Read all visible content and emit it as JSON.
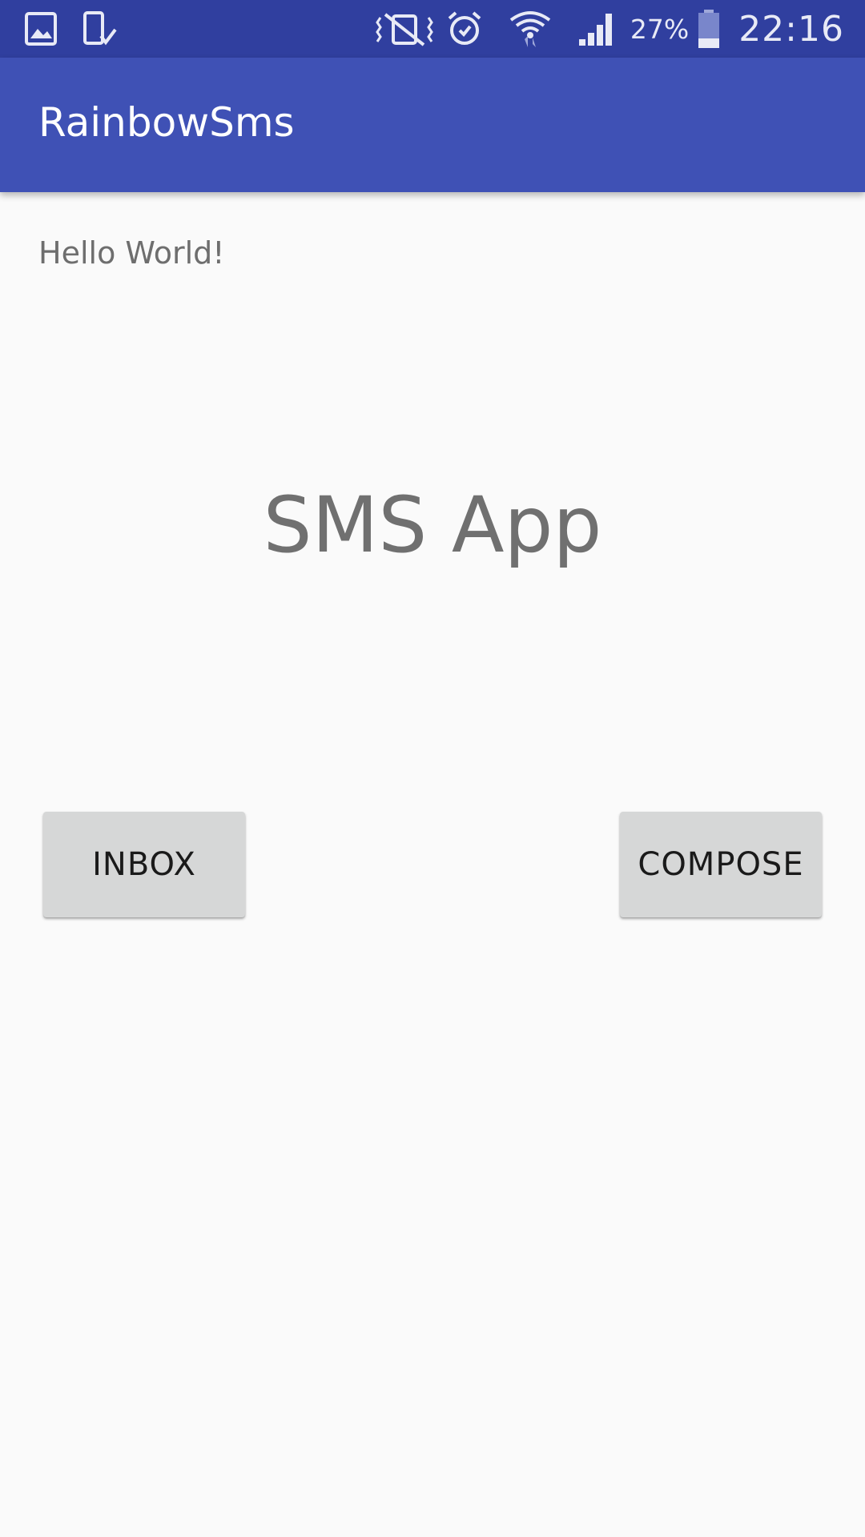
{
  "status_bar": {
    "icons_left": [
      "gallery-icon",
      "device-download-icon"
    ],
    "icons_right": [
      "vibrate-icon",
      "alarm-icon",
      "wifi-icon",
      "signal-icon",
      "battery-icon"
    ],
    "battery_percent": "27%",
    "battery_level": 0.27,
    "time": "22:16"
  },
  "app_bar": {
    "title": "RainbowSms"
  },
  "main": {
    "greeting": "Hello World!",
    "headline": "SMS App",
    "inbox_button": "INBOX",
    "compose_button": "COMPOSE"
  },
  "colors": {
    "status_bar": "#303f9f",
    "app_bar": "#3f51b5",
    "background": "#fafafa",
    "button": "#d6d7d7"
  }
}
